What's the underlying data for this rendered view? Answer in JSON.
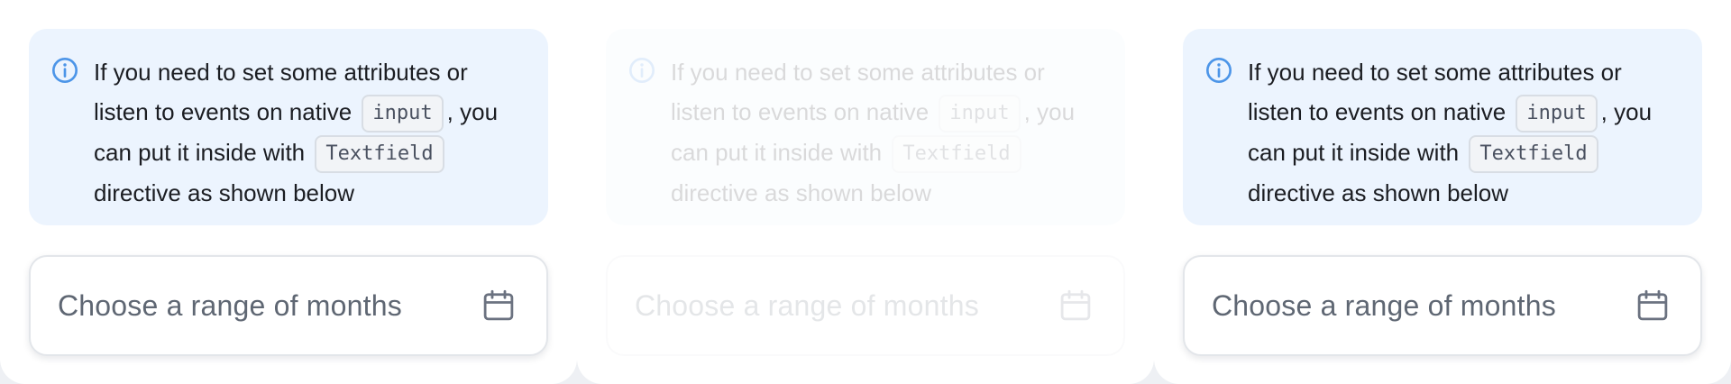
{
  "notice": {
    "line1": "If you need to set some attributes or listen to events on native",
    "code1": "input",
    "line2": ", you can put it inside with",
    "code2": "Textfield",
    "line3": "directive as shown below"
  },
  "range_field": {
    "placeholder": "Choose a range of months",
    "icon": "calendar-icon"
  },
  "icons": {
    "info": "info-icon",
    "calendar": "calendar-icon"
  },
  "colors": {
    "notice_background": "#ecf4fe",
    "info_icon": "#4c95e8",
    "text": "#1b1d22",
    "placeholder": "#5f6773",
    "icon_gray": "#6b7280"
  }
}
